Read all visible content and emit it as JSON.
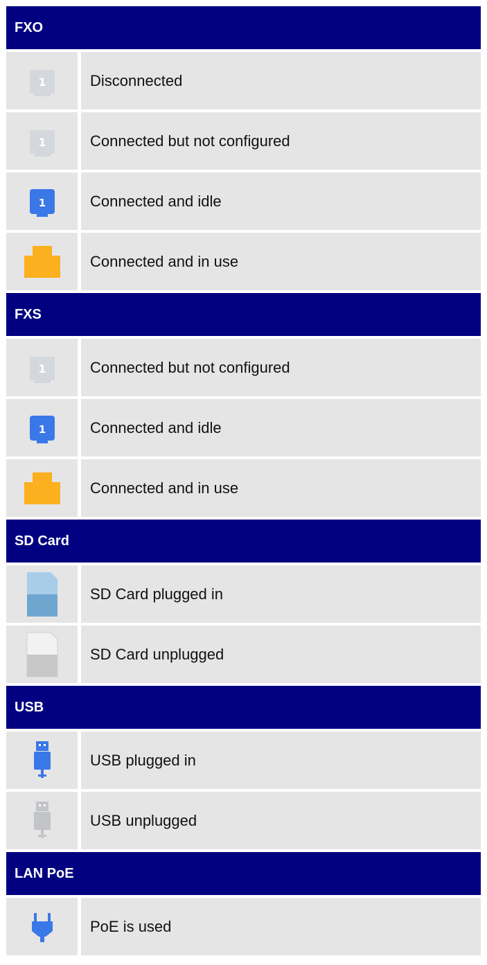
{
  "sections": [
    {
      "title": "FXO",
      "rows": [
        {
          "icon": "port-1-gray-icon",
          "label": "Disconnected"
        },
        {
          "icon": "port-1-gray-icon",
          "label": "Connected but not configured"
        },
        {
          "icon": "port-1-blue-icon",
          "label": "Connected and idle"
        },
        {
          "icon": "port-orange-icon",
          "label": "Connected and in use"
        }
      ]
    },
    {
      "title": "FXS",
      "rows": [
        {
          "icon": "port-1-gray-icon",
          "label": "Connected but not configured"
        },
        {
          "icon": "port-1-blue-icon",
          "label": "Connected and idle"
        },
        {
          "icon": "port-orange-icon",
          "label": "Connected and in use"
        }
      ]
    },
    {
      "title": "SD Card",
      "rows": [
        {
          "icon": "sd-card-blue-icon",
          "label": "SD Card plugged in"
        },
        {
          "icon": "sd-card-gray-icon",
          "label": "SD Card unplugged"
        }
      ]
    },
    {
      "title": "USB",
      "rows": [
        {
          "icon": "usb-blue-icon",
          "label": "USB plugged in"
        },
        {
          "icon": "usb-gray-icon",
          "label": "USB unplugged"
        }
      ]
    },
    {
      "title": "LAN PoE",
      "rows": [
        {
          "icon": "poe-plug-blue-icon",
          "label": "PoE is used"
        }
      ]
    }
  ],
  "colors": {
    "header_bg": "#000080",
    "row_bg": "#e5e5e5",
    "port_gray": "#d4d8dd",
    "port_blue": "#3b78e7",
    "port_orange": "#fbb01f",
    "sd_blue": "#7fb2d6",
    "sd_gray": "#cfcfcf"
  }
}
